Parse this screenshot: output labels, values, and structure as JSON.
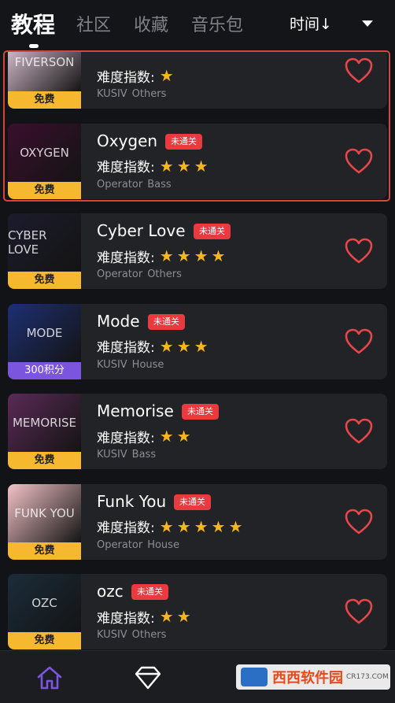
{
  "tabs": [
    {
      "label": "教程",
      "active": true
    },
    {
      "label": "社区",
      "active": false
    },
    {
      "label": "收藏",
      "active": false
    },
    {
      "label": "音乐包",
      "active": false
    }
  ],
  "sort": {
    "label": "时间↓"
  },
  "difficulty_label": "难度指数:",
  "songs": [
    {
      "title": "FIVERSON",
      "art_text": "FIVERSON",
      "tag": "免费",
      "stars": 1,
      "badge": "",
      "meta1": "KUSIV",
      "meta2": "Others",
      "thumb_color": "#e9cfe1"
    },
    {
      "title": "Oxygen",
      "art_text": "OXYGEN",
      "tag": "免费",
      "stars": 3,
      "badge": "未通关",
      "meta1": "Operator",
      "meta2": "Bass",
      "thumb_color": "#3a0f2d"
    },
    {
      "title": "Cyber Love",
      "art_text": "CYBER LOVE",
      "tag": "免费",
      "stars": 4,
      "badge": "未通关",
      "meta1": "Operator",
      "meta2": "Others",
      "thumb_color": "#1c1b2c"
    },
    {
      "title": "Mode",
      "art_text": "MODE",
      "tag": "300积分",
      "stars": 3,
      "badge": "未通关",
      "meta1": "KUSIV",
      "meta2": "House",
      "thumb_color": "#1d2f73"
    },
    {
      "title": "Memorise",
      "art_text": "MEMORISE",
      "tag": "免费",
      "stars": 2,
      "badge": "未通关",
      "meta1": "KUSIV",
      "meta2": "Bass",
      "thumb_color": "#5a2a56"
    },
    {
      "title": "Funk You",
      "art_text": "FUNK YOU",
      "tag": "免费",
      "stars": 5,
      "badge": "未通关",
      "meta1": "Operator",
      "meta2": "House",
      "thumb_color": "#f3c3c7"
    },
    {
      "title": "ozc",
      "art_text": "OZC",
      "tag": "免费",
      "stars": 2,
      "badge": "未通关",
      "meta1": "KUSIV",
      "meta2": "Others",
      "thumb_color": "#1b2c3a"
    }
  ],
  "bottom_nav": [
    {
      "icon": "home-icon"
    },
    {
      "icon": "diamond-icon"
    },
    {
      "icon": "box-icon"
    }
  ],
  "watermark": {
    "text": "西西软件园",
    "sub": "CR173.COM"
  },
  "colors": {
    "accent_purple": "#7b55dd",
    "heart_red": "#e7474a",
    "star_gold": "#f7b51e",
    "tag_gold": "#f6b82f",
    "badge_red": "#e83a3f"
  }
}
